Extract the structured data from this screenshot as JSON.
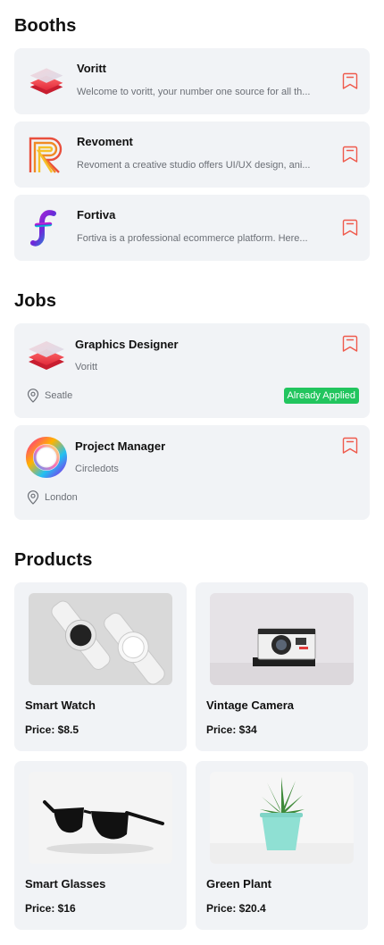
{
  "sections": {
    "booths": "Booths",
    "jobs": "Jobs",
    "products": "Products"
  },
  "booths": [
    {
      "name": "Voritt",
      "description": "Welcome to voritt, your number one source for all th...",
      "icon": "voritt-logo"
    },
    {
      "name": "Revoment",
      "description": "Revoment a creative studio offers UI/UX design, ani...",
      "icon": "revoment-logo"
    },
    {
      "name": "Fortiva",
      "description": "Fortiva is a professional ecommerce platform. Here...",
      "icon": "fortiva-logo"
    }
  ],
  "jobs": [
    {
      "title": "Graphics Designer",
      "company": "Voritt",
      "location": "Seatle",
      "status": "Already Applied"
    },
    {
      "title": "Project Manager",
      "company": "Circledots",
      "location": "London"
    }
  ],
  "products": [
    {
      "name": "Smart Watch",
      "price": "Price: $8.5"
    },
    {
      "name": "Vintage Camera",
      "price": "Price: $34"
    },
    {
      "name": "Smart Glasses",
      "price": "Price: $16"
    },
    {
      "name": "Green Plant",
      "price": "Price: $20.4"
    }
  ],
  "colors": {
    "card_bg": "#f1f3f6",
    "bookmark": "#ef5a4c",
    "applied_badge": "#22c55e",
    "muted_text": "#6b6f76"
  }
}
